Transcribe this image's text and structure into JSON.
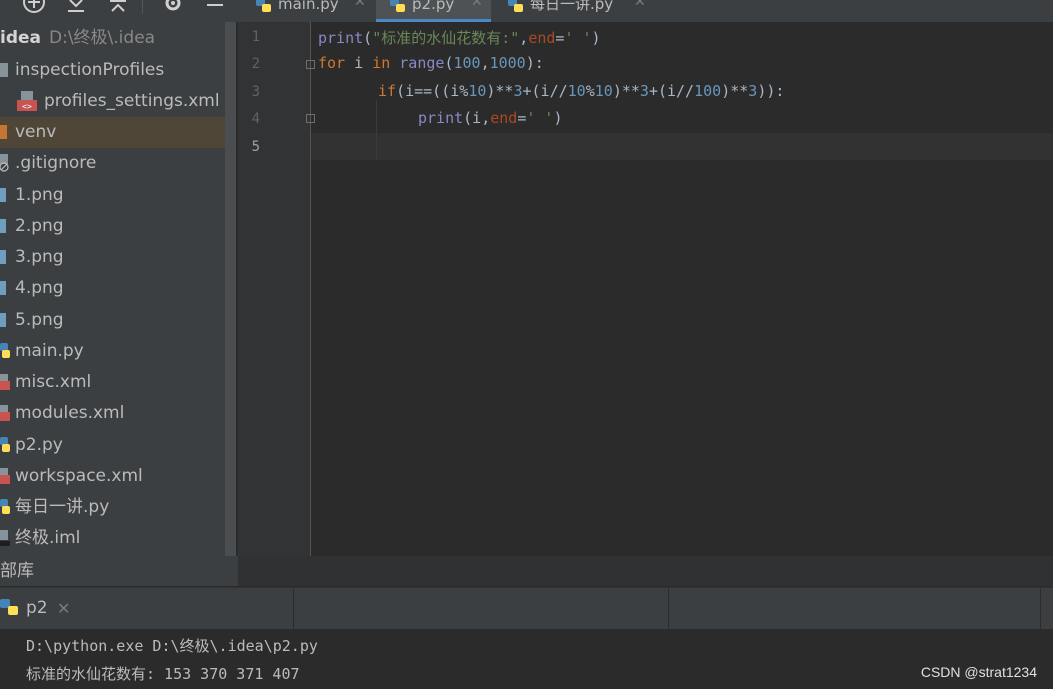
{
  "editor_tabs": [
    {
      "label": "main.py",
      "active": false
    },
    {
      "label": "p2.py",
      "active": true
    },
    {
      "label": "每日一讲.py",
      "active": false
    }
  ],
  "project": {
    "root_name": "idea",
    "root_path": "D:\\终极\\.idea",
    "items": [
      {
        "label": "inspectionProfiles",
        "icon": "folder-icon"
      },
      {
        "label": "profiles_settings.xml",
        "icon": "xml-file-icon"
      },
      {
        "label": "venv",
        "icon": "folder-icon",
        "selected": true
      },
      {
        "label": ".gitignore",
        "icon": "ignore-file-icon"
      },
      {
        "label": "1.png",
        "icon": "image-file-icon"
      },
      {
        "label": "2.png",
        "icon": "image-file-icon"
      },
      {
        "label": "3.png",
        "icon": "image-file-icon"
      },
      {
        "label": "4.png",
        "icon": "image-file-icon"
      },
      {
        "label": "5.png",
        "icon": "image-file-icon"
      },
      {
        "label": "main.py",
        "icon": "python-file-icon"
      },
      {
        "label": "misc.xml",
        "icon": "xml-file-icon"
      },
      {
        "label": "modules.xml",
        "icon": "xml-file-icon"
      },
      {
        "label": "p2.py",
        "icon": "python-file-icon"
      },
      {
        "label": "workspace.xml",
        "icon": "xml-file-icon"
      },
      {
        "label": "每日一讲.py",
        "icon": "python-file-icon"
      },
      {
        "label": "终极.iml",
        "icon": "iml-file-icon"
      }
    ],
    "external_libraries": "部库"
  },
  "editor": {
    "line_numbers": [
      "1",
      "2",
      "3",
      "4",
      "5"
    ],
    "code": {
      "l1": {
        "fn": "print",
        "p1": "(",
        "str": "\"标准的水仙花数有:\"",
        "p2": ",",
        "param": "end",
        "p3": "=",
        "str2": "' '",
        "p4": ")"
      },
      "l2": {
        "kw1": "for",
        "p1": " i ",
        "kw2": "in",
        "p2": " ",
        "fn": "range",
        "p3": "(",
        "n1": "100",
        "p4": ",",
        "n2": "1000",
        "p5": "):"
      },
      "l3": {
        "kw": "if",
        "p1": "(i==((i%",
        "n1": "10",
        "p2": ")**",
        "n2": "3",
        "p3": "+(i//",
        "n3": "10",
        "p4": "%",
        "n4": "10",
        "p5": ")**",
        "n5": "3",
        "p6": "+(i//",
        "n6": "100",
        "p7": ")**",
        "n7": "3",
        "p8": ")):"
      },
      "l4": {
        "fn": "print",
        "p1": "(i,",
        "param": "end",
        "p2": "=",
        "str": "' '",
        "p3": ")"
      }
    }
  },
  "run": {
    "tab_label": "p2",
    "console_lines": [
      "D:\\python.exe D:\\终极\\.idea\\p2.py",
      "标准的水仙花数有: 153 370 371 407"
    ]
  },
  "watermark": "CSDN @strat1234",
  "colors": {
    "keyword": "#cc7832",
    "builtin": "#8888c6",
    "string": "#6a8759",
    "number": "#6897bb",
    "param": "#aa4926",
    "selection": "#4f4638",
    "active_tab_underline": "#4a88c7"
  }
}
